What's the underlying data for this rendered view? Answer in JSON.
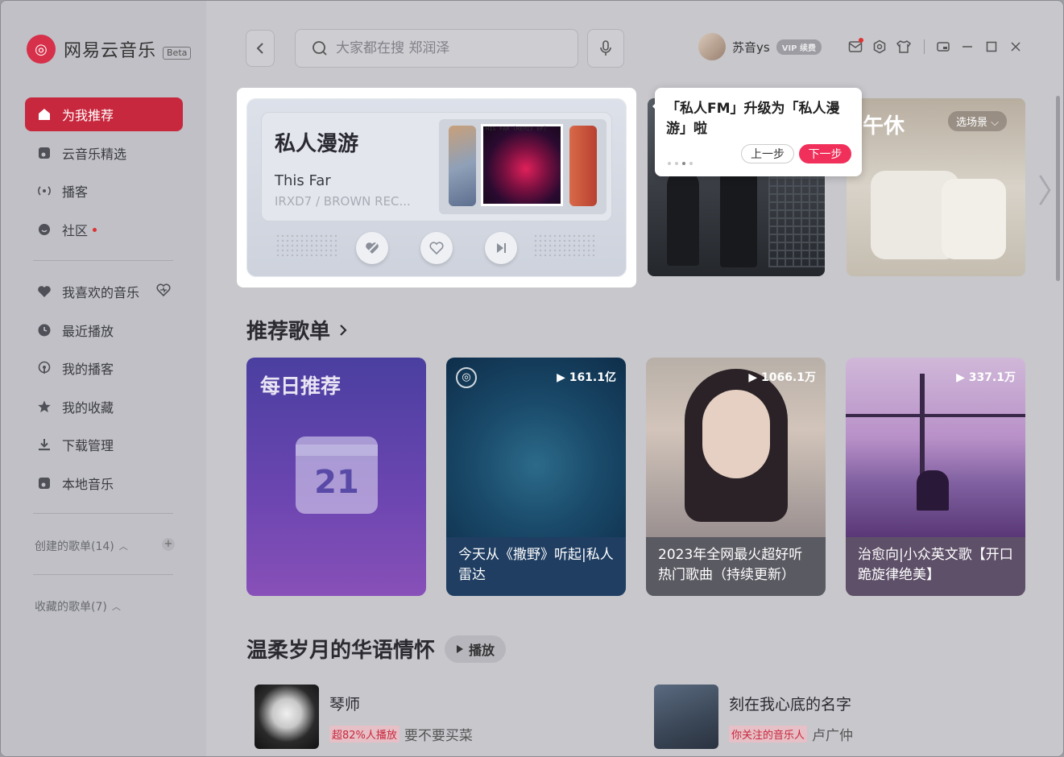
{
  "app": {
    "name": "网易云音乐",
    "beta": "Beta",
    "logo_glyph": "◎"
  },
  "sidebar": {
    "items": [
      {
        "label": "为我推荐",
        "icon": "home-icon",
        "active": true
      },
      {
        "label": "云音乐精选",
        "icon": "music-note-icon"
      },
      {
        "label": "播客",
        "icon": "podcast-icon"
      },
      {
        "label": "社区",
        "icon": "chat-icon",
        "dot": true
      },
      {
        "label": "我喜欢的音乐",
        "icon": "heart-icon"
      },
      {
        "label": "最近播放",
        "icon": "clock-icon"
      },
      {
        "label": "我的播客",
        "icon": "podcast-icon"
      },
      {
        "label": "我的收藏",
        "icon": "star-icon"
      },
      {
        "label": "下载管理",
        "icon": "download-icon"
      },
      {
        "label": "本地音乐",
        "icon": "music-note-icon"
      }
    ],
    "created_playlists": "创建的歌单(14)",
    "collected_playlists": "收藏的歌单(7)"
  },
  "topbar": {
    "search_placeholder": "大家都在搜 郑润泽",
    "username": "苏音ys",
    "vip": "VIP 续费"
  },
  "fm": {
    "title": "私人漫游",
    "song": "This Far",
    "artist": "IRXD7 / BROWN REC...",
    "cover_caption": "HIS FAR (REMIX EP)"
  },
  "tooltip": {
    "text": "「私人FM」升级为「私人漫游」啦",
    "prev": "上一步",
    "next": "下一步"
  },
  "scene": {
    "label": "午休",
    "button": "选场景"
  },
  "recommend": {
    "title": "推荐歌单",
    "daily_title": "每日推荐",
    "daily_date": "21",
    "playlists": [
      {
        "count": "161.1亿",
        "caption": "今天从《撒野》听起|私人雷达"
      },
      {
        "count": "1066.1万",
        "caption": "2023年全网最火超好听热门歌曲（持续更新）"
      },
      {
        "count": "337.1万",
        "caption": "治愈向|小众英文歌【开口跪旋律绝美】"
      }
    ]
  },
  "section2": {
    "title": "温柔岁月的华语情怀",
    "play": "播放",
    "songs": [
      {
        "name": "琴师",
        "tag": "超82%人播放",
        "artist": "要不要买菜"
      },
      {
        "name": "刻在我心底的名字",
        "tag": "你关注的音乐人",
        "artist": "卢广仲"
      }
    ]
  }
}
